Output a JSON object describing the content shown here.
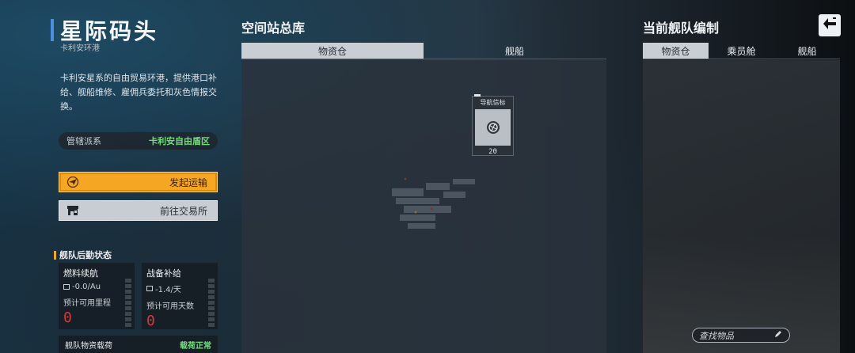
{
  "port": {
    "title": "星际码头",
    "subtitle": "卡利安环港",
    "description": "卡利安星系的自由贸易环港，提供港口补给、舰船维修、雇佣兵委托和灰色情报交换。",
    "faction_label": "管辖派系",
    "faction_value": "卡利安自由盾区",
    "transport_button": "发起运输",
    "trade_button": "前往交易所"
  },
  "fleet_status": {
    "section_title": "舰队后勤状态",
    "fuel": {
      "name": "燃料续航",
      "rate": "-0.0/Au",
      "estimate_label": "预计可用里程",
      "value": "0"
    },
    "supply": {
      "name": "战备补给",
      "rate": "-1.4/天",
      "estimate_label": "预计可用天数",
      "value": "0"
    },
    "load_label": "舰队物资载荷",
    "load_value": "载荷正常"
  },
  "station": {
    "title": "空间站总库",
    "tabs": [
      "物资仓",
      "舰船"
    ],
    "active_tab": 0,
    "item": {
      "name": "导航信标",
      "quantity": "20"
    }
  },
  "fleet": {
    "title": "当前舰队编制",
    "tabs": [
      "物资仓",
      "乘员舱",
      "舰船"
    ],
    "active_tab": 0,
    "search_placeholder": "查找物品"
  },
  "colors": {
    "accent_orange": "#f5a623",
    "status_green": "#6fe07a",
    "warning_red": "#d23a3a",
    "title_bar_blue": "#4a8fe0"
  },
  "icons": {
    "transport": "paper-plane-icon",
    "trade": "shop-icon",
    "back": "back-arrow-icon",
    "search": "pencil-icon"
  }
}
